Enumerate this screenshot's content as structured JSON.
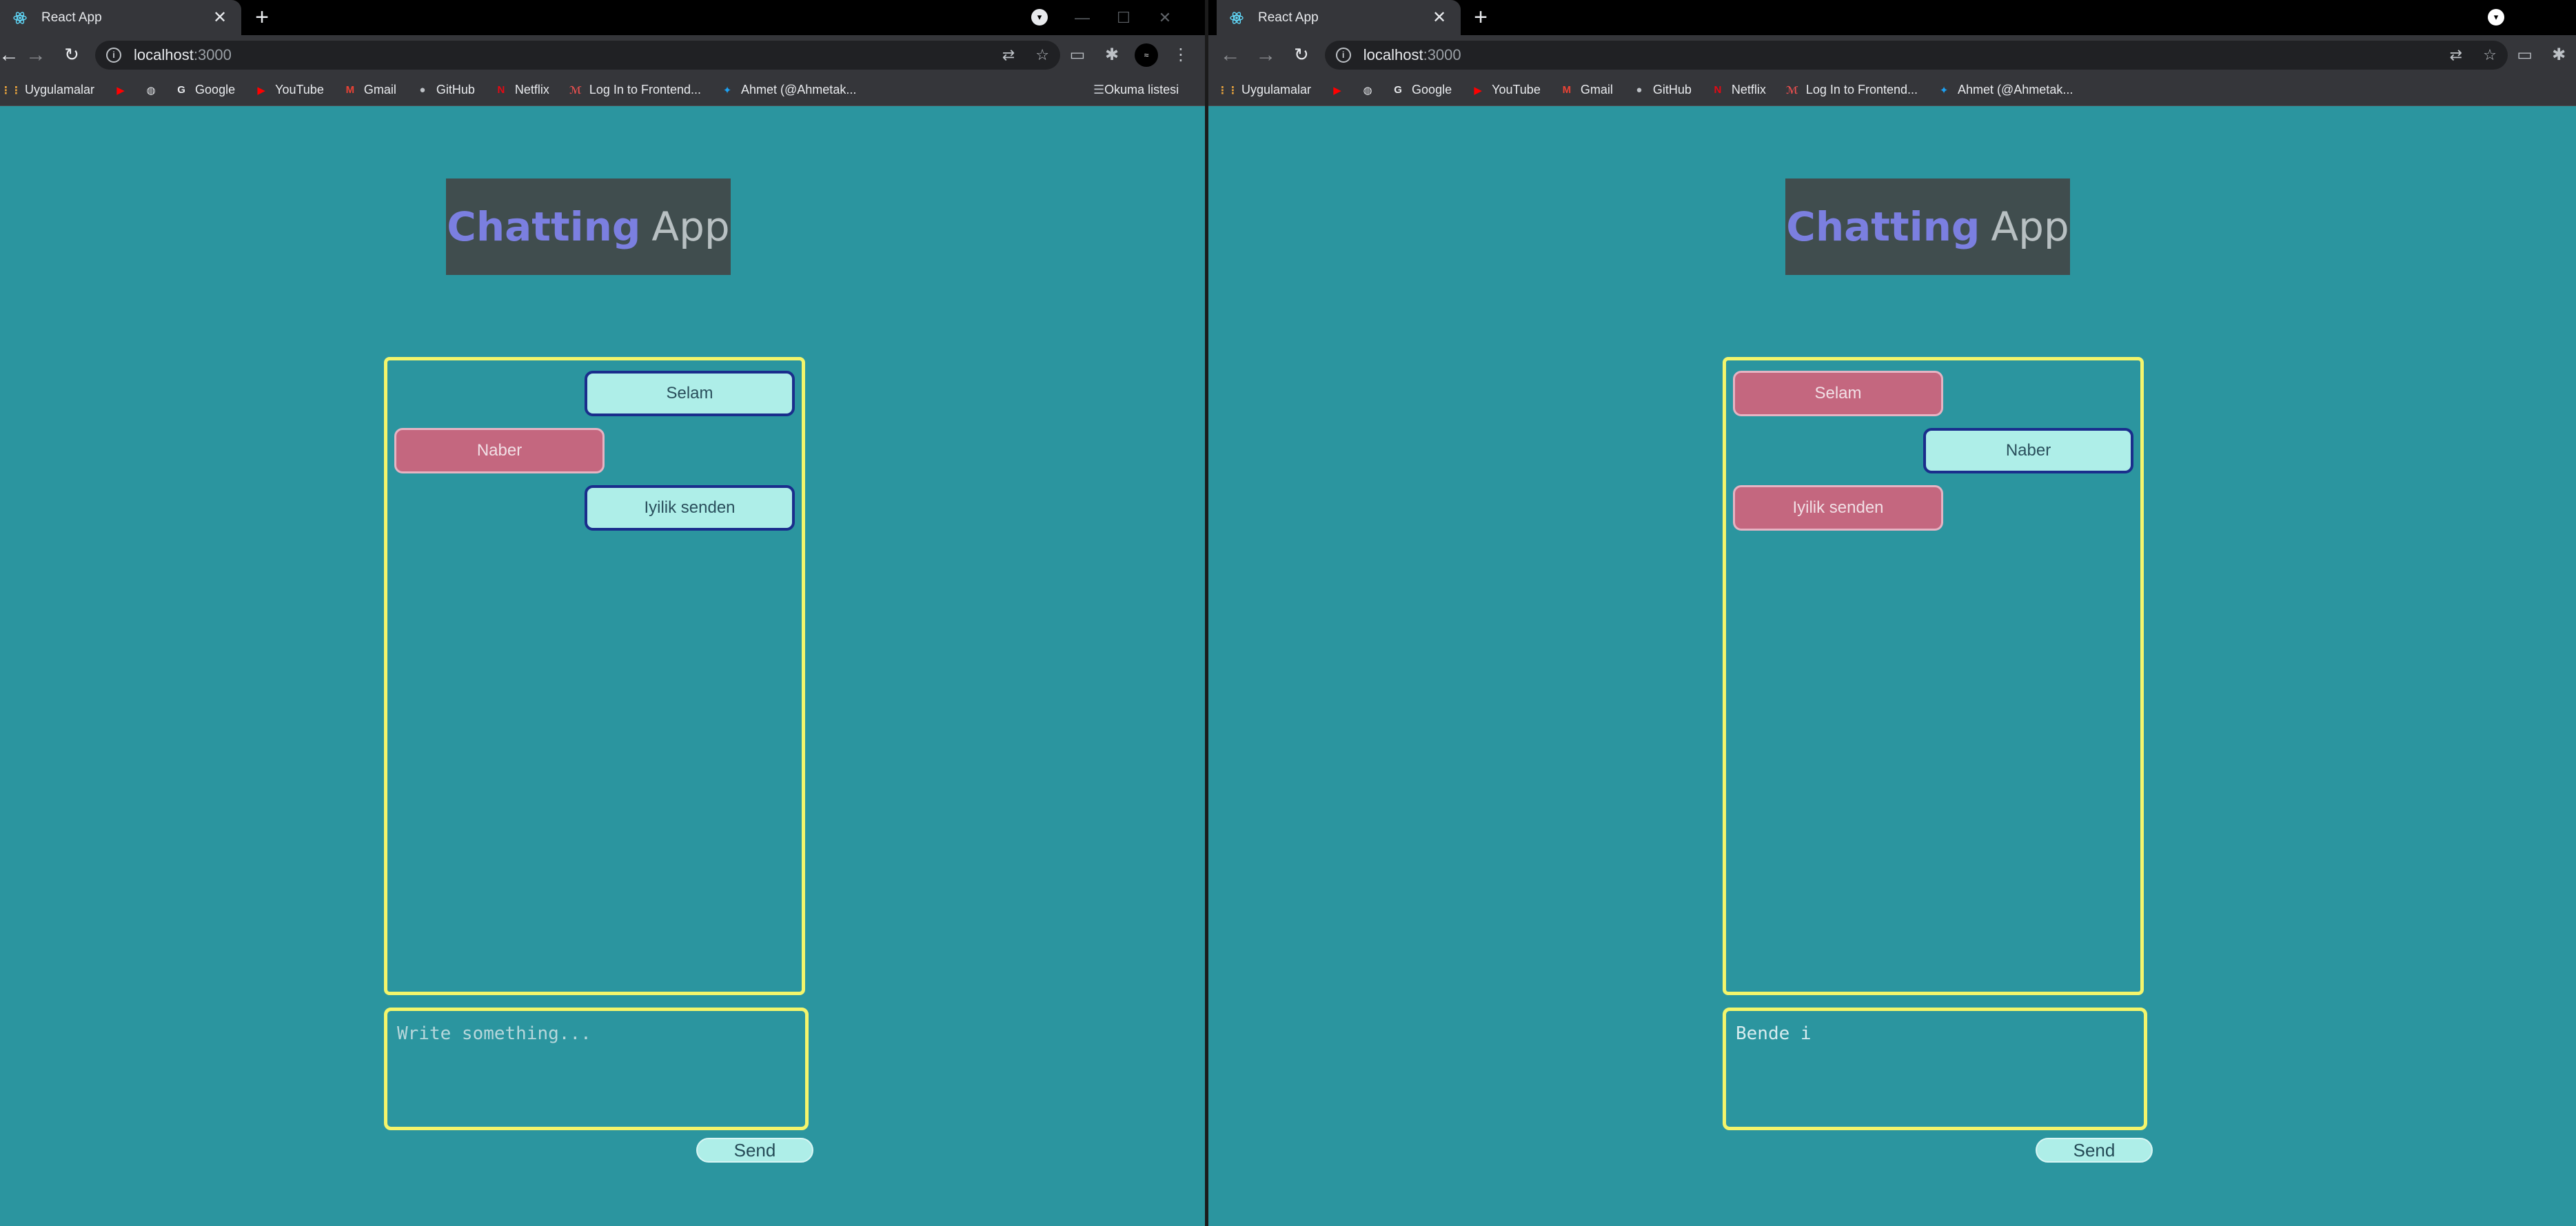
{
  "browser": {
    "tab_title": "React App",
    "url_host": "localhost",
    "url_port": ":3000",
    "bookmarks": [
      "Uygulamalar",
      "",
      "",
      "Google",
      "YouTube",
      "Gmail",
      "GitHub",
      "Netflix",
      "Log In to Frontend...",
      "Ahmet (@Ahmetak..."
    ],
    "reading_list": "Okuma listesi"
  },
  "app": {
    "title_part1": "Chatting",
    "title_part2": "App",
    "send_label": "Send",
    "placeholder": "Write something..."
  },
  "left_window": {
    "messages": [
      {
        "text": "Selam",
        "side": "right"
      },
      {
        "text": "Naber",
        "side": "left"
      },
      {
        "text": "Iyilik senden",
        "side": "right"
      }
    ],
    "compose_value": ""
  },
  "right_window": {
    "messages": [
      {
        "text": "Selam",
        "side": "left"
      },
      {
        "text": "Naber",
        "side": "right"
      },
      {
        "text": "Iyilik senden",
        "side": "left"
      }
    ],
    "compose_value": "Bende i"
  },
  "colors": {
    "page_bg": "#2b959f",
    "title_bg": "#404d4e",
    "title_accent": "#7b7fe0",
    "box_border": "#f4f56b",
    "bubble_out": "#aeeee8",
    "bubble_in": "#c4677f"
  }
}
